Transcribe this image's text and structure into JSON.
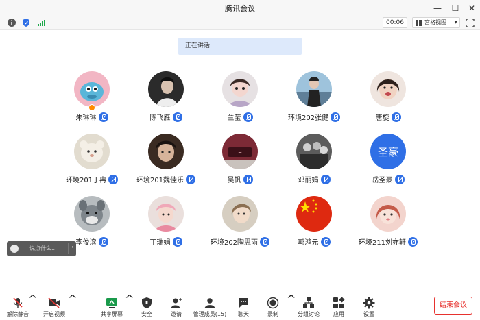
{
  "window": {
    "title": "腾讯会议"
  },
  "topbar": {
    "timer": "00:06",
    "view_mode": "宫格视图"
  },
  "speaking": {
    "label": "正在讲话:"
  },
  "participants": [
    {
      "name": "朱琳琳",
      "avatar_color": "#f2b6c4"
    },
    {
      "name": "陈飞雁",
      "avatar_color": "#2b2b2b"
    },
    {
      "name": "兰莹",
      "avatar_color": "#c6a4a8"
    },
    {
      "name": "环境202张健",
      "avatar_color": "#7da6c8"
    },
    {
      "name": "唐旋",
      "avatar_color": "#d9b7a4"
    },
    {
      "name": "环境201丁冉",
      "avatar_color": "#d7cab0"
    },
    {
      "name": "环境201魏佳乐",
      "avatar_color": "#3a2b22"
    },
    {
      "name": "吴帆",
      "avatar_color": "#7d2a36"
    },
    {
      "name": "邓丽娟",
      "avatar_color": "#5c5c5c"
    },
    {
      "name": "岳圣豪",
      "avatar_color": "#2f6fe6",
      "avatar_text": "圣豪"
    },
    {
      "name": "李俊滨",
      "avatar_color": "#8a8f94"
    },
    {
      "name": "丁瑞娟",
      "avatar_color": "#e9c9c4"
    },
    {
      "name": "环境202陶思雨",
      "avatar_color": "#d6cec1"
    },
    {
      "name": "郭鸿元",
      "avatar_color": "#de2910"
    },
    {
      "name": "环境211刘亦轩",
      "avatar_color": "#e9b5a7"
    }
  ],
  "chat": {
    "placeholder": "说点什么..."
  },
  "toolbar": {
    "unmute": "解除静音",
    "start_video": "开启视频",
    "share_screen": "共享屏幕",
    "security": "安全",
    "invite": "邀请",
    "manage_members": "管理成员(15)",
    "chat": "聊天",
    "record": "录制",
    "breakout": "分组讨论",
    "apps": "应用",
    "settings": "设置",
    "end_meeting": "结束会议"
  },
  "colors": {
    "accent": "#2f6fe6",
    "danger": "#e7322e",
    "banner": "#dde9fb"
  }
}
